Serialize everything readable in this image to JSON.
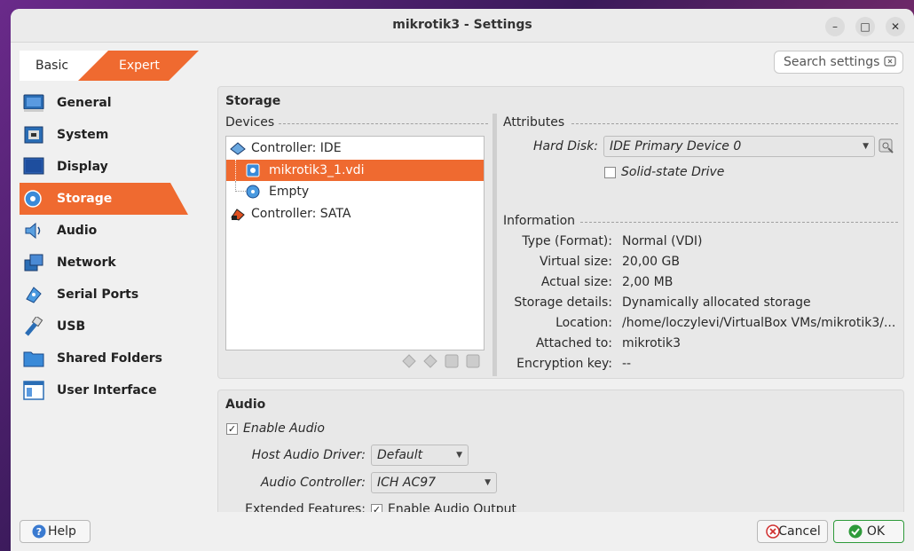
{
  "window": {
    "title": "mikrotik3 - Settings"
  },
  "mode": {
    "basic": "Basic",
    "expert": "Expert"
  },
  "search": {
    "placeholder": "Search settings"
  },
  "sidebar": {
    "items": [
      {
        "label": "General",
        "icon": "general-icon"
      },
      {
        "label": "System",
        "icon": "system-icon"
      },
      {
        "label": "Display",
        "icon": "display-icon"
      },
      {
        "label": "Storage",
        "icon": "storage-icon",
        "active": true
      },
      {
        "label": "Audio",
        "icon": "audio-icon"
      },
      {
        "label": "Network",
        "icon": "network-icon"
      },
      {
        "label": "Serial Ports",
        "icon": "serial-ports-icon"
      },
      {
        "label": "USB",
        "icon": "usb-icon"
      },
      {
        "label": "Shared Folders",
        "icon": "shared-folders-icon"
      },
      {
        "label": "User Interface",
        "icon": "user-interface-icon"
      }
    ]
  },
  "storage": {
    "title": "Storage",
    "devices_label": "Devices",
    "tree": [
      {
        "label": "Controller: IDE",
        "level": 0,
        "icon": "ide-controller-icon"
      },
      {
        "label": "mikrotik3_1.vdi",
        "level": 1,
        "icon": "hard-disk-icon",
        "selected": true
      },
      {
        "label": "Empty",
        "level": 1,
        "icon": "optical-disc-icon"
      },
      {
        "label": "Controller: SATA",
        "level": 0,
        "icon": "sata-controller-icon"
      }
    ],
    "attributes_label": "Attributes",
    "hard_disk_label": "Hard Disk:",
    "hard_disk_value": "IDE Primary Device 0",
    "ssd_label": "Solid-state Drive",
    "ssd_checked": false,
    "information_label": "Information",
    "info": [
      {
        "label": "Type (Format):",
        "value": "Normal (VDI)"
      },
      {
        "label": "Virtual size:",
        "value": "20,00 GB"
      },
      {
        "label": "Actual size:",
        "value": "2,00 MB"
      },
      {
        "label": "Storage details:",
        "value": "Dynamically allocated storage"
      },
      {
        "label": "Location:",
        "value": "/home/loczylevi/VirtualBox VMs/mikrotik3/..."
      },
      {
        "label": "Attached to:",
        "value": "mikrotik3"
      },
      {
        "label": "Encryption key:",
        "value": "--"
      }
    ]
  },
  "audio": {
    "title": "Audio",
    "enable_label": "Enable Audio",
    "enable_checked": true,
    "host_driver_label": "Host Audio Driver:",
    "host_driver_value": "Default",
    "controller_label": "Audio Controller:",
    "controller_value": "ICH AC97",
    "extended_label": "Extended Features:",
    "output_label": "Enable Audio Output",
    "output_checked": true
  },
  "buttons": {
    "help": "Help",
    "cancel": "Cancel",
    "ok": "OK"
  },
  "colors": {
    "accent": "#ef6a30",
    "ok_icon": "#2e9a3a",
    "help_icon": "#3a7ad0"
  }
}
